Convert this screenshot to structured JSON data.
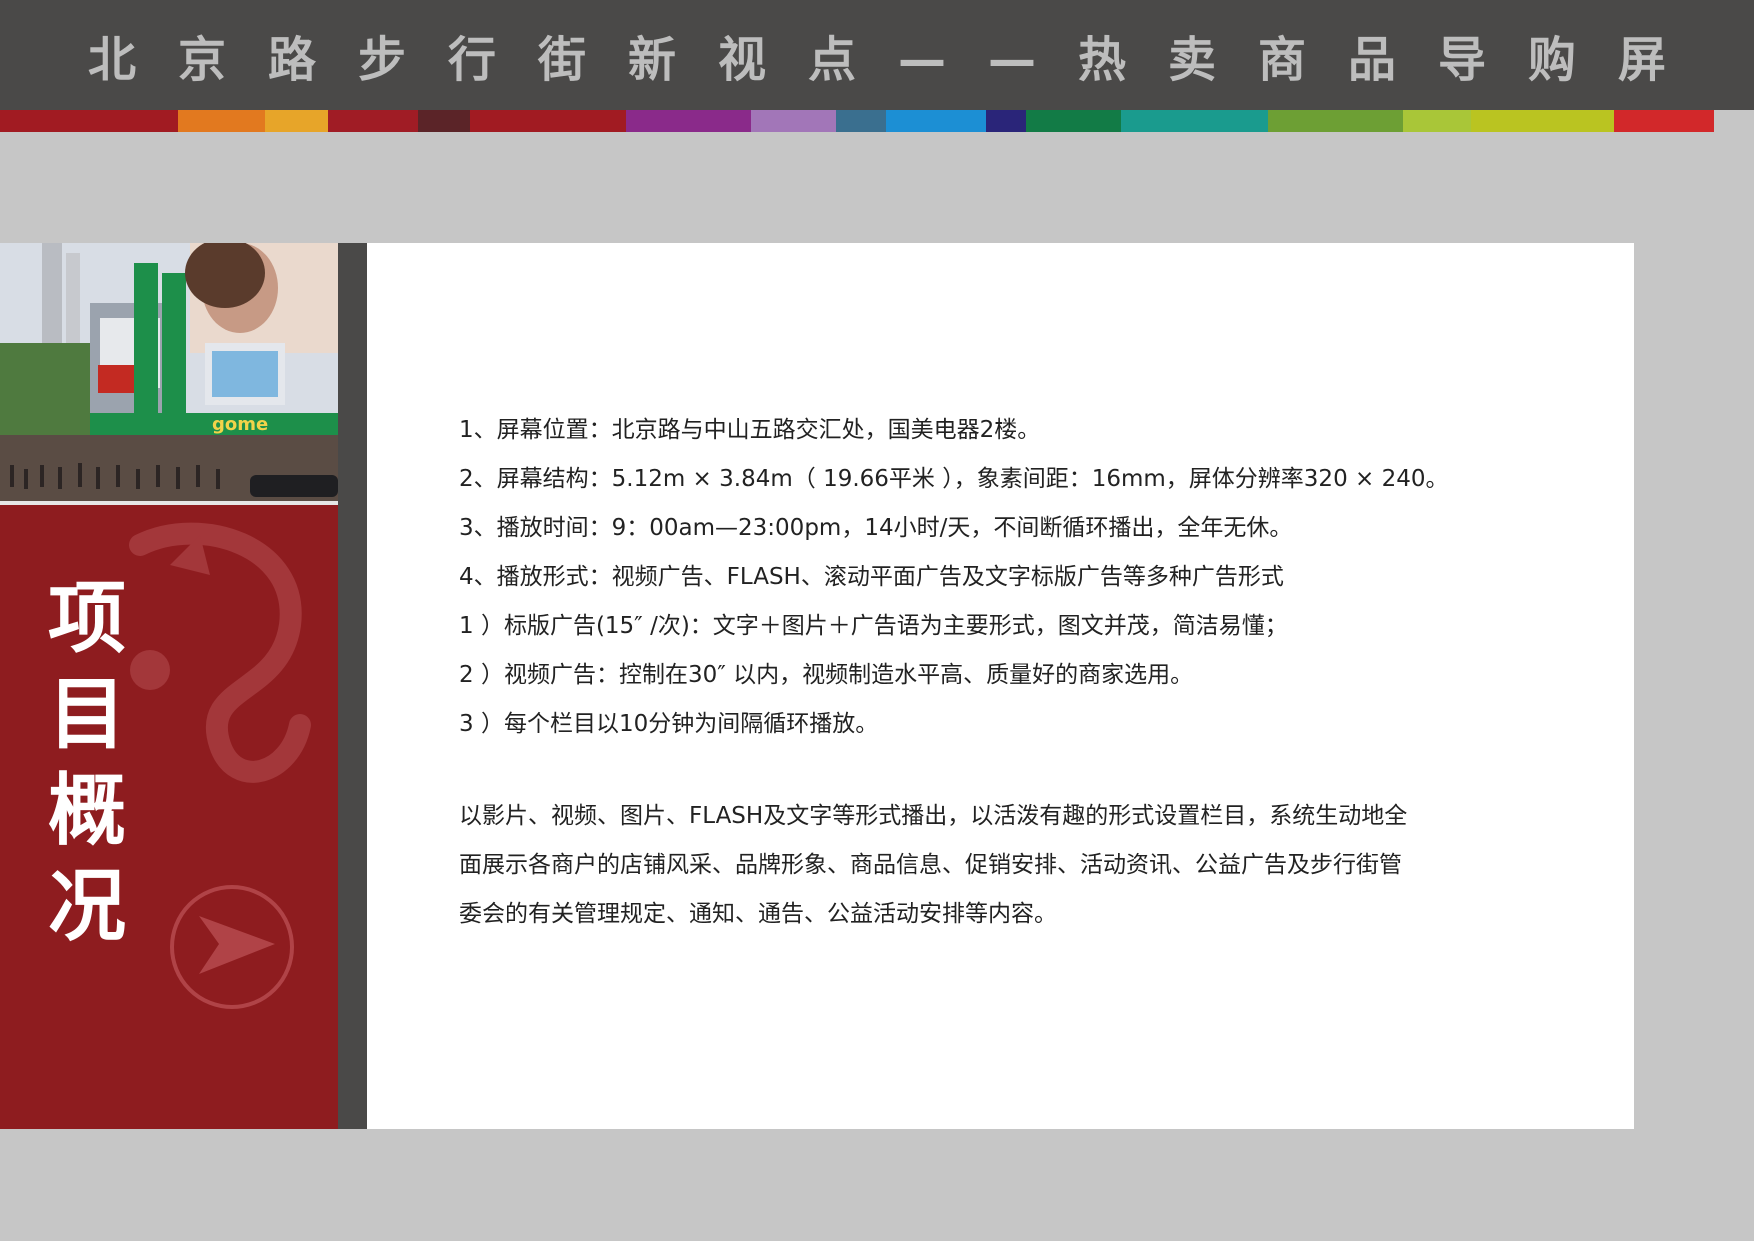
{
  "header": {
    "title": "北京路步行街新视点——热卖商品导购屏"
  },
  "colors": {
    "strip": [
      "#a11b22",
      "#e2791f",
      "#e7a529",
      "#a01c25",
      "#5b2428",
      "#a11b22",
      "#8a2a8a",
      "#a276b8",
      "#3a6f8f",
      "#1c8fd4",
      "#2a2579",
      "#127b46",
      "#1a9b8e",
      "#6d9f34",
      "#a9c638",
      "#bac421",
      "#d2282a"
    ]
  },
  "sidebar": {
    "title_chars": [
      "项",
      "目",
      "概",
      "况"
    ]
  },
  "content": {
    "items": [
      "1、屏幕位置：北京路与中山五路交汇处，国美电器2楼。",
      "2、屏幕结构：5.12m × 3.84m（ 19.66平米 ），象素间距：16mm，屏体分辨率320 × 240。",
      "3、播放时间：9：00am—23:00pm，14小时/天，不间断循环播出，全年无休。",
      "4、播放形式：视频广告、FLASH、滚动平面广告及文字标版广告等多种广告形式",
      "1 ）标版广告(15″ /次)：文字＋图片＋广告语为主要形式，图文并茂，简洁易懂；",
      "2 ）视频广告：控制在30″ 以内，视频制造水平高、质量好的商家选用。",
      "3 ）每个栏目以10分钟为间隔循环播放。"
    ],
    "paragraph_lines": [
      "以影片、视频、图片、FLASH及文字等形式播出，以活泼有趣的形式设置栏目，系统生动地全",
      "面展示各商户的店铺风采、品牌形象、商品信息、促销安排、活动资讯、公益广告及步行街管",
      "委会的有关管理规定、通知、通告、公益活动安排等内容。"
    ]
  },
  "photo": {
    "sign_text": "gome"
  }
}
